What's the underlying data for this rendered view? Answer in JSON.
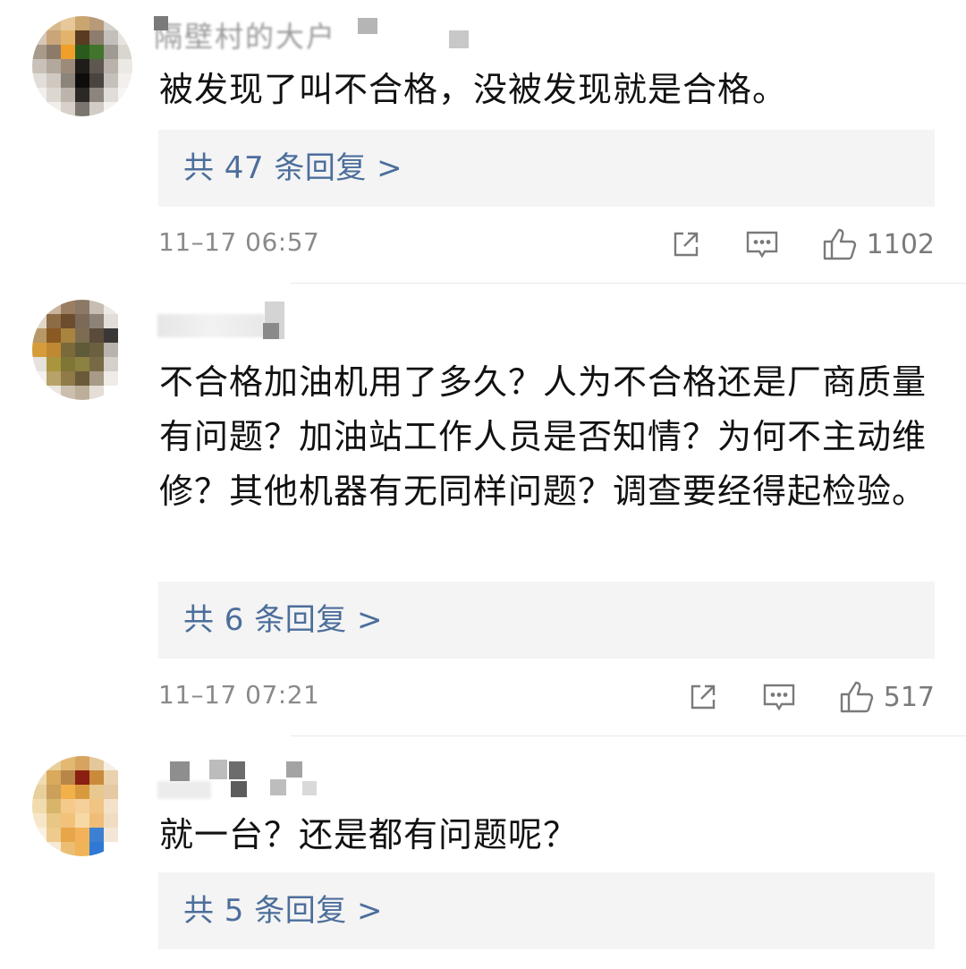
{
  "comments": [
    {
      "username": "隔壁村的大户",
      "text": "被发现了叫不合格，没被发现就是合格。",
      "replies_label": "共 47 条回复 >",
      "time": "11–17 06:57",
      "likes": "1102"
    },
    {
      "username": "",
      "text": "不合格加油机用了多久？人为不合格还是厂商质量有问题？加油站工作人员是否知情？为何不主动维修？其他机器有无同样问题？调查要经得起检验。",
      "replies_label": "共 6 条回复 >",
      "time": "11–17 07:21",
      "likes": "517"
    },
    {
      "username": "",
      "text": "就一台？还是都有问题呢？",
      "replies_label": "共 5 条回复 >"
    }
  ],
  "icons": {
    "share": "share-icon",
    "comment": "comment-icon",
    "like": "thumbs-up-icon"
  },
  "colors": {
    "link": "#4c6e9b",
    "reply_bg": "#f4f4f4",
    "meta_text": "#8a8a8a"
  }
}
